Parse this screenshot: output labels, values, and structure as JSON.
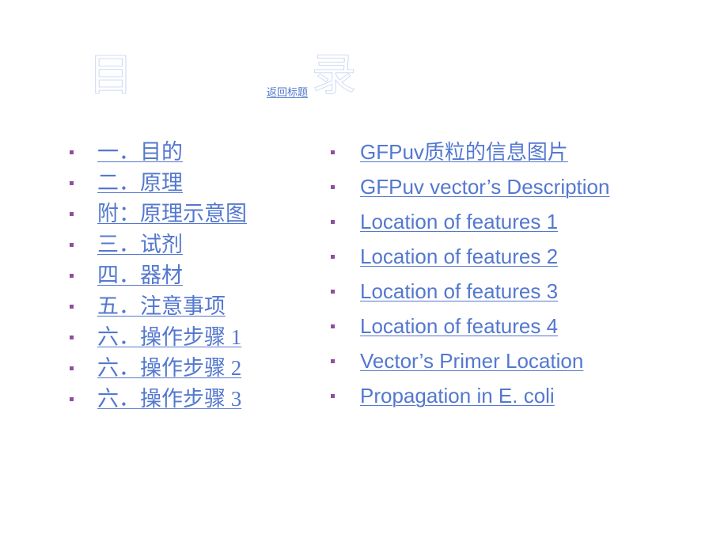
{
  "slide": {
    "title": "目    录",
    "back_link_label": "返回标题",
    "background_color": "#ffffff",
    "link_color": "#5478cf",
    "bullet_color": "#8f4f9e",
    "title_outline_color": "#cfdaf3"
  },
  "left_column": {
    "items": [
      {
        "label": "一．目的"
      },
      {
        "label": "二．原理"
      },
      {
        "label": "附：原理示意图"
      },
      {
        "label": "三．试剂"
      },
      {
        "label": "四．器材"
      },
      {
        "label": "五．注意事项"
      },
      {
        "label": "六．操作步骤 1"
      },
      {
        "label": "六．操作步骤 2"
      },
      {
        "label": "六．操作步骤 3"
      }
    ]
  },
  "right_column": {
    "items": [
      {
        "label": "GFPuv质粒的信息图片"
      },
      {
        "label": "GFPuv vector’s Description"
      },
      {
        "label": "Location of features 1"
      },
      {
        "label": "Location of features 2"
      },
      {
        "label": "Location of features 3"
      },
      {
        "label": "Location of features 4"
      },
      {
        "label": "Vector’s Primer Location"
      },
      {
        "label": "Propagation in E. coli"
      }
    ]
  }
}
